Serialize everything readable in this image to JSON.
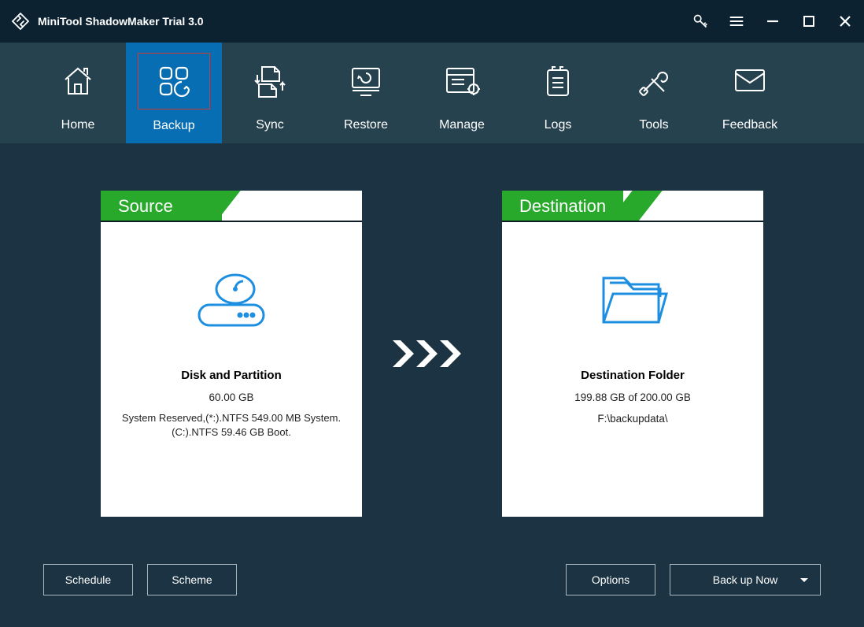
{
  "title": "MiniTool ShadowMaker Trial 3.0",
  "nav": {
    "home": "Home",
    "backup": "Backup",
    "sync": "Sync",
    "restore": "Restore",
    "manage": "Manage",
    "logs": "Logs",
    "tools": "Tools",
    "feedback": "Feedback"
  },
  "source": {
    "header": "Source",
    "title": "Disk and Partition",
    "size": "60.00 GB",
    "detail": "System Reserved,(*:).NTFS 549.00 MB System. (C:).NTFS 59.46 GB Boot."
  },
  "destination": {
    "header": "Destination",
    "title": "Destination Folder",
    "size": "199.88 GB of 200.00 GB",
    "detail": "F:\\backupdata\\"
  },
  "buttons": {
    "schedule": "Schedule",
    "scheme": "Scheme",
    "options": "Options",
    "backup_now": "Back up Now"
  }
}
